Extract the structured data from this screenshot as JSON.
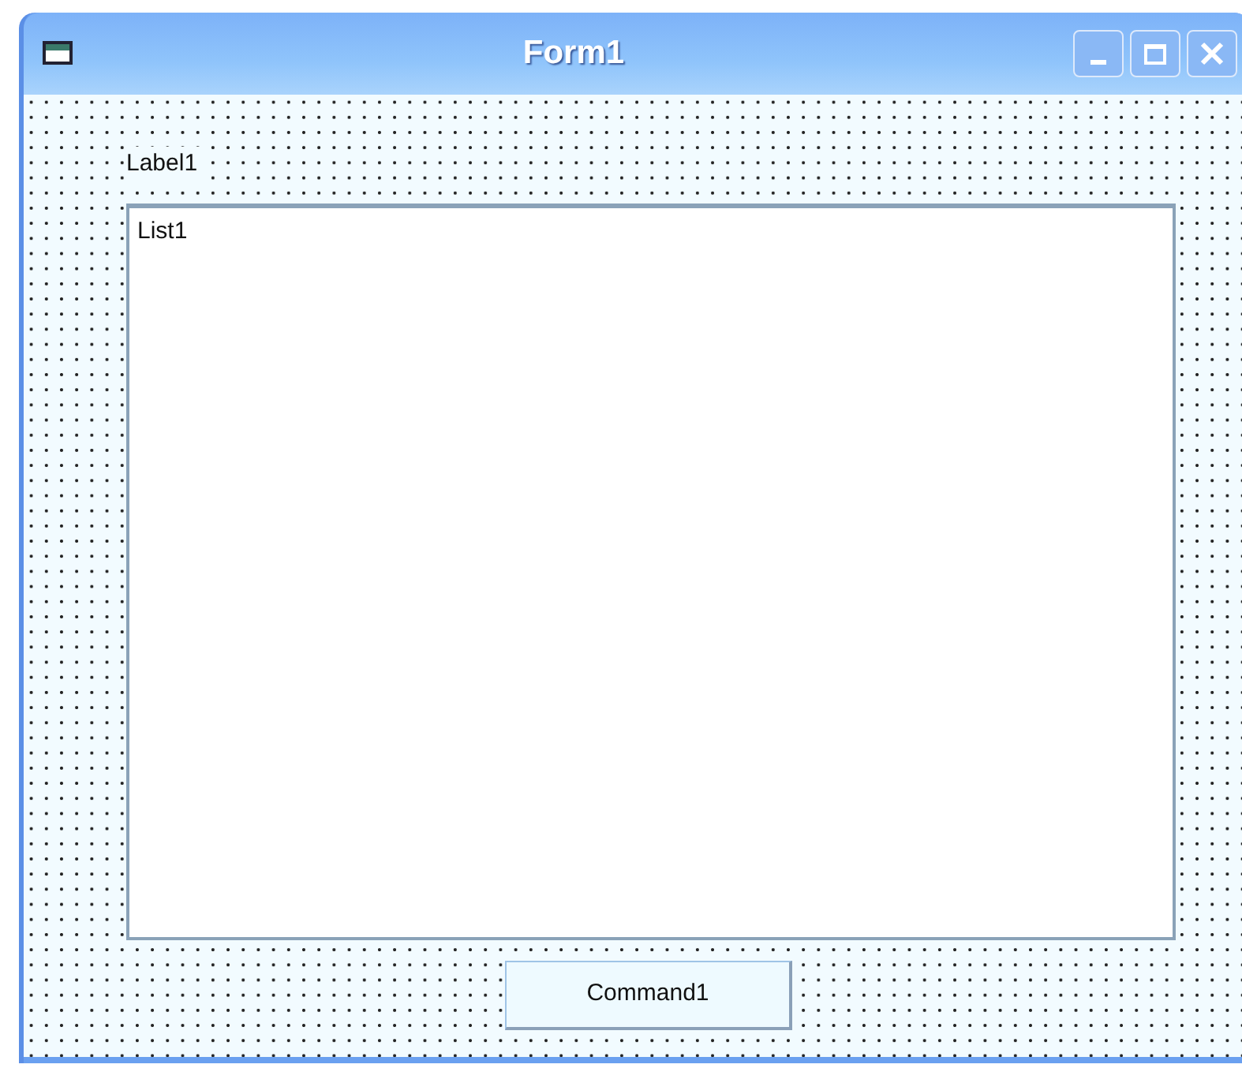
{
  "window": {
    "title": "Form1"
  },
  "label": {
    "text": "Label1"
  },
  "list": {
    "text": "List1"
  },
  "button": {
    "label": "Command1"
  }
}
